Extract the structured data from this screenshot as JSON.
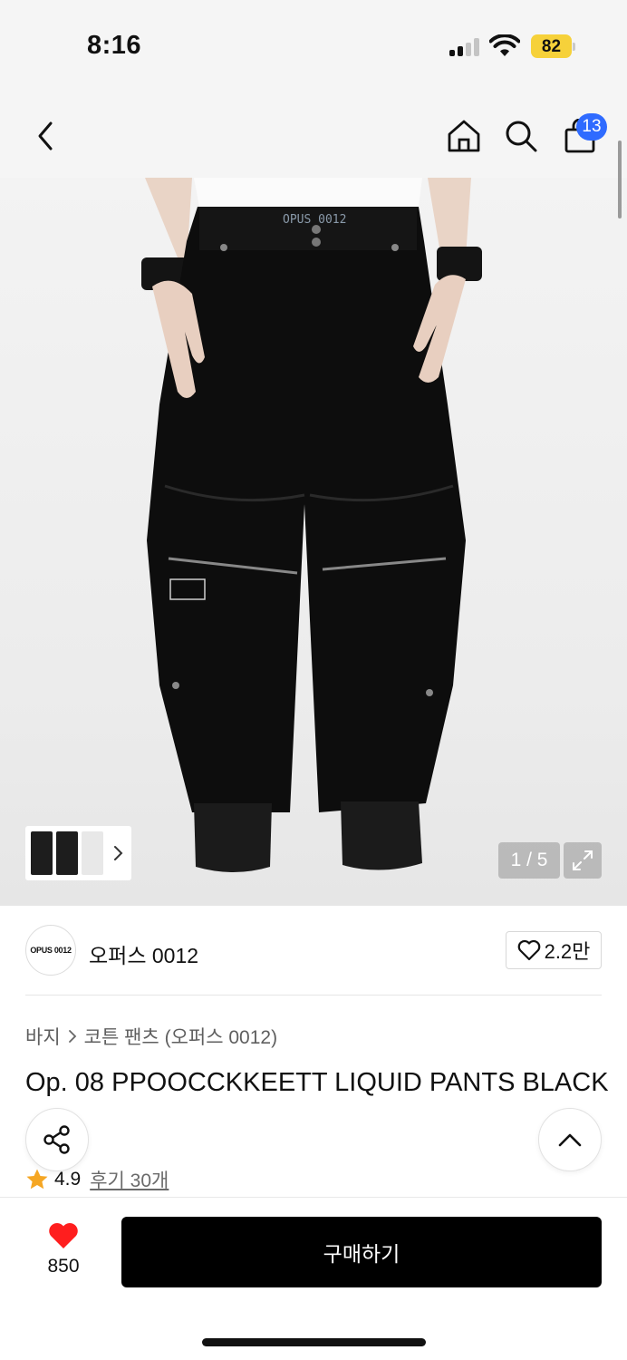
{
  "status_bar": {
    "time": "8:16",
    "battery": "82",
    "battery_color": "#f6d13a"
  },
  "nav": {
    "back_icon": "chevron-left-icon",
    "home_icon": "home-icon",
    "search_icon": "search-icon",
    "cart_icon": "shopping-bag-icon",
    "cart_count": "13",
    "badge_color": "#2f6bff"
  },
  "gallery": {
    "pager": "1 / 5",
    "expand_icon": "expand-icon",
    "thumbnail_arrow_icon": "chevron-right-icon",
    "print_text": "OPUS 0012"
  },
  "brand": {
    "logo_text": "OPUS 0012",
    "name": "오퍼스 0012",
    "like_count": "2.2만"
  },
  "breadcrumb": {
    "category": "바지",
    "subcategory": "코튼 팬츠 (오퍼스 0012)"
  },
  "product": {
    "title": "Op. 08 PPOOCCKKEETT LIQUID PANTS BLACK",
    "rating": "4.9",
    "reviews": "후기 30개",
    "star_color": "#f5a623"
  },
  "actions": {
    "share_icon": "share-icon",
    "top_icon": "chevron-up-icon",
    "wish_count": "850",
    "wish_color": "#ff1e1e",
    "buy_label": "구매하기"
  }
}
